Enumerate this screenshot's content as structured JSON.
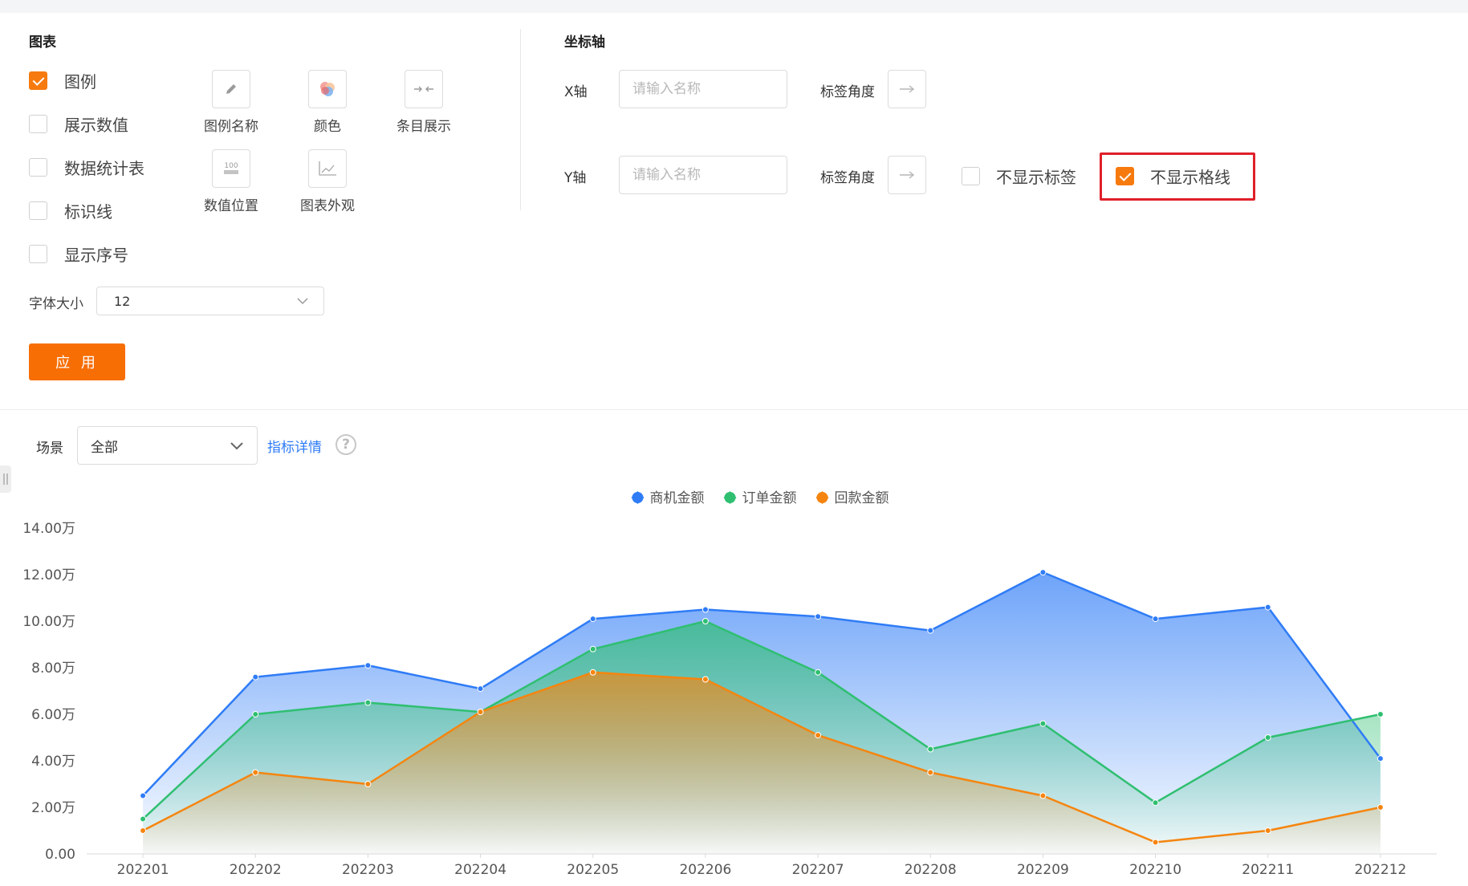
{
  "chart_panel": {
    "section_title": "图表",
    "checkboxes": [
      {
        "label": "图例",
        "checked": true
      },
      {
        "label": "展示数值",
        "checked": false
      },
      {
        "label": "数据统计表",
        "checked": false
      },
      {
        "label": "标识线",
        "checked": false
      },
      {
        "label": "显示序号",
        "checked": false
      }
    ],
    "tools": [
      {
        "label": "图例名称",
        "icon": "pencil-icon"
      },
      {
        "label": "颜色",
        "icon": "color-circles-icon"
      },
      {
        "label": "条目展示",
        "icon": "arrows-inward-icon"
      },
      {
        "label": "数值位置",
        "icon": "value-position-icon"
      },
      {
        "label": "图表外观",
        "icon": "line-chart-icon"
      }
    ],
    "value_position_icon_text": "100",
    "font_size_label": "字体大小",
    "font_size_value": "12",
    "apply_label": "应 用"
  },
  "axis_panel": {
    "section_title": "坐标轴",
    "x_axis_label": "X轴",
    "y_axis_label": "Y轴",
    "name_placeholder": "请输入名称",
    "label_angle": "标签角度",
    "hide_labels": {
      "label": "不显示标签",
      "checked": false
    },
    "hide_gridlines": {
      "label": "不显示格线",
      "checked": true
    }
  },
  "filter": {
    "scene_label": "场景",
    "scene_value": "全部",
    "metric_link": "指标详情",
    "help_symbol": "?"
  },
  "colors": {
    "accent": "#f77a0e",
    "blue": "#2f7cf6",
    "green": "#2fbf71",
    "orange": "#f5850f",
    "highlight": "#e0202a"
  },
  "chart_data": {
    "type": "area",
    "categories": [
      "202201",
      "202202",
      "202203",
      "202204",
      "202205",
      "202206",
      "202207",
      "202208",
      "202209",
      "202210",
      "202211",
      "202212"
    ],
    "series": [
      {
        "name": "商机金额",
        "color": "#2f7cf6",
        "values": [
          2.5,
          7.6,
          8.1,
          7.1,
          10.1,
          10.5,
          10.2,
          9.6,
          12.1,
          10.1,
          10.6,
          4.1
        ]
      },
      {
        "name": "订单金额",
        "color": "#2fbf71",
        "values": [
          1.5,
          6.0,
          6.5,
          6.1,
          8.8,
          10.0,
          7.8,
          4.5,
          5.6,
          2.2,
          5.0,
          6.0
        ]
      },
      {
        "name": "回款金额",
        "color": "#f5850f",
        "values": [
          1.0,
          3.5,
          3.0,
          6.1,
          7.8,
          7.5,
          5.1,
          3.5,
          2.5,
          0.5,
          1.0,
          2.0
        ]
      }
    ],
    "yticks": [
      "0.00",
      "2.00万",
      "4.00万",
      "6.00万",
      "8.00万",
      "10.00万",
      "12.00万",
      "14.00万"
    ],
    "ylim": [
      0,
      14
    ],
    "grid": false,
    "legend_position": "top-center"
  }
}
